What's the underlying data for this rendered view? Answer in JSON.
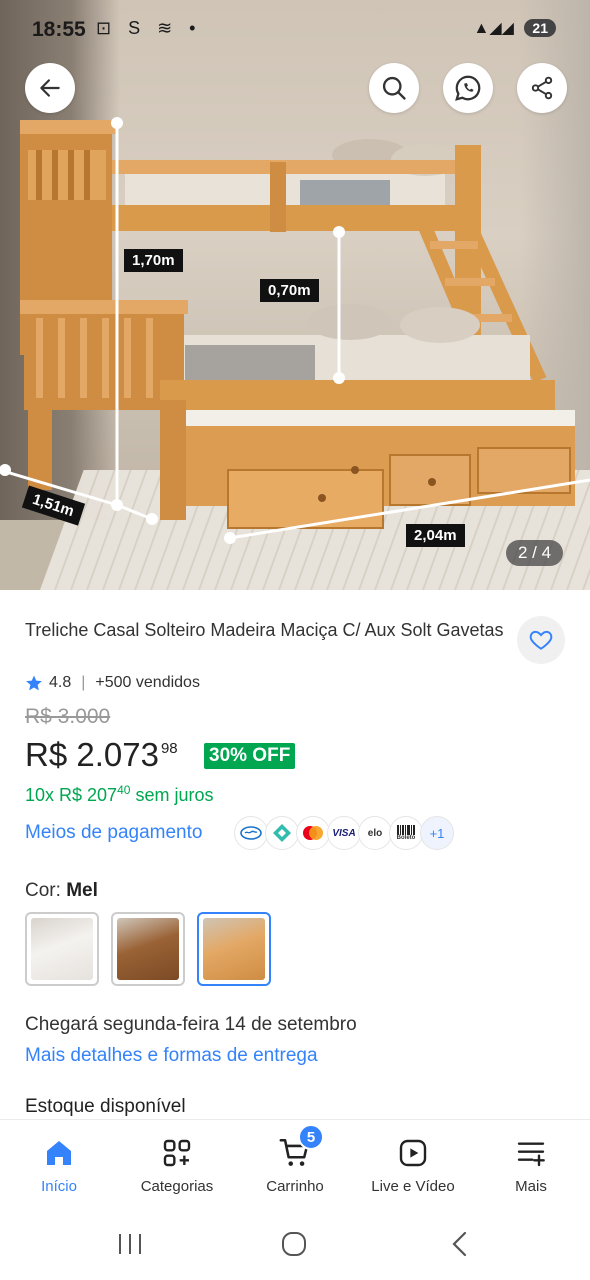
{
  "status_bar": {
    "time": "18:55",
    "left_icons": "⊡ S ≋ •",
    "battery": "21"
  },
  "hero": {
    "dimensions": {
      "height_total": "1,70m",
      "height_lower": "0,70m",
      "depth": "1,51m",
      "width": "2,04m"
    },
    "image_counter": "2 / 4",
    "icons": [
      "back-arrow-icon",
      "search-icon",
      "whatsapp-icon",
      "share-icon"
    ]
  },
  "product": {
    "title": "Treliche Casal Solteiro Madeira Maciça C/ Aux Solt Gavetas",
    "rating": "4.8",
    "sold": "+500 vendidos",
    "old_price": "R$ 3.000",
    "price_main": "R$ 2.073",
    "price_cents": "98",
    "discount": "30% OFF",
    "installments_prefix": "10x R$ 207",
    "installments_cents": "40",
    "installments_suffix": "sem juros",
    "payment_link": "Meios de pagamento",
    "payment_methods": [
      "VISA",
      "elo",
      "Boleto"
    ],
    "payment_more": "+1",
    "color_label": "Cor:",
    "color_value": "Mel",
    "delivery_prefix": "Chegará segunda-feira",
    "delivery_day": "14",
    "delivery_suffix": "de setembro",
    "delivery_link": "Mais detalhes e formas de entrega",
    "stock": "Estoque disponível"
  },
  "bottom_nav": {
    "items": [
      {
        "label": "Início",
        "icon": "home-icon"
      },
      {
        "label": "Categorias",
        "icon": "categories-icon"
      },
      {
        "label": "Carrinho",
        "icon": "cart-icon"
      },
      {
        "label": "Live e Vídeo",
        "icon": "play-video-icon"
      },
      {
        "label": "Mais",
        "icon": "menu-plus-icon"
      }
    ],
    "cart_count": "5"
  },
  "colors": {
    "accent_blue": "#3483fa",
    "green": "#00a650",
    "wood": "#d99a4c"
  }
}
